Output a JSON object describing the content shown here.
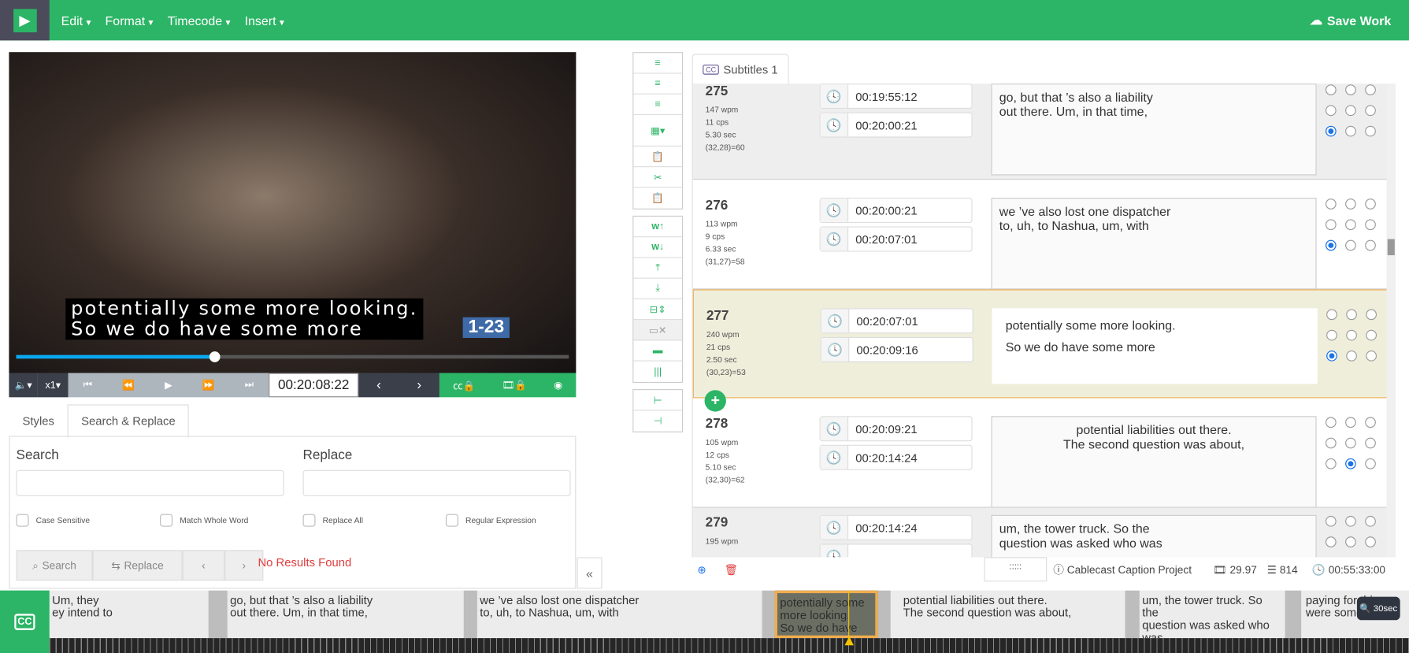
{
  "menu": {
    "items": [
      "Edit",
      "Format",
      "Timecode",
      "Insert"
    ],
    "save": "Save Work"
  },
  "video": {
    "subtitle_line1": "potentially some more looking.",
    "subtitle_line2": "So we do have some more",
    "badge": "1-23",
    "progress_percent": 36
  },
  "controls": {
    "speed": "x1",
    "timecode": "00:20:08:22"
  },
  "tabs": [
    "Styles",
    "Search & Replace"
  ],
  "search": {
    "search_label": "Search",
    "replace_label": "Replace",
    "search_value": "",
    "replace_value": "",
    "options": [
      "Case Sensitive",
      "Match Whole Word",
      "Replace All",
      "Regular Expression"
    ],
    "search_btn": "Search",
    "replace_btn": "Replace",
    "status": "No Results Found"
  },
  "subtitles_tab": "Subtitles 1",
  "rows": [
    {
      "num": "275",
      "wpm": "147 wpm",
      "cps": "11 cps",
      "sec": "5.30 sec",
      "chars": "(32,28)=60",
      "start": "00:19:55:12",
      "end": "00:20:00:21",
      "text": "go, but that ’s also a liability\nout there. Um, in that time,",
      "align": "left",
      "radio": 6
    },
    {
      "num": "276",
      "wpm": "113 wpm",
      "cps": "9 cps",
      "sec": "6.33 sec",
      "chars": "(31,27)=58",
      "start": "00:20:00:21",
      "end": "00:20:07:01",
      "text": "we ’ve also lost one dispatcher\nto, uh, to Nashua, um, with",
      "align": "left",
      "radio": 6
    },
    {
      "num": "277",
      "wpm": "240 wpm",
      "cps": "21 cps",
      "sec": "2.50 sec",
      "chars": "(30,23)=53",
      "start": "00:20:07:01",
      "end": "00:20:09:16",
      "text": "potentially some more looking.\nSo we do have some more",
      "align": "left",
      "radio": 6
    },
    {
      "num": "278",
      "wpm": "105 wpm",
      "cps": "12 cps",
      "sec": "5.10 sec",
      "chars": "(32,30)=62",
      "start": "00:20:09:21",
      "end": "00:20:14:24",
      "text": "potential liabilities out there.\nThe second question was about,",
      "align": "center",
      "radio": 7
    },
    {
      "num": "279",
      "wpm": "195 wpm",
      "cps": "",
      "sec": "",
      "chars": "",
      "start": "00:20:14:24",
      "end": "",
      "text": "um, the tower truck. So the\nquestion was asked who was",
      "align": "left",
      "radio": -1
    }
  ],
  "footer": {
    "project": "Cablecast Caption Project",
    "fps": "29.97",
    "count": "814",
    "duration": "00:55:33:00"
  },
  "timeline": {
    "blocks": [
      "Um, they\ney intend to",
      "go, but that ’s also a liability\nout there. Um, in that time,",
      "we ’ve also lost one dispatcher\nto, uh, to Nashua, um, with",
      "potentially some\nmore looking.\nSo we do have\nsome more",
      "potential liabilities out there.\nThe second question was about,",
      "um, the tower truck. So\nthe\nquestion was asked who\nwas",
      "paying for this\nwere some"
    ],
    "zoom": "30sec"
  },
  "colors": {
    "brand": "#2cb566",
    "highlight_row": "#efeedb",
    "highlight_border": "#f0ad4e",
    "error": "#e03c3c"
  }
}
